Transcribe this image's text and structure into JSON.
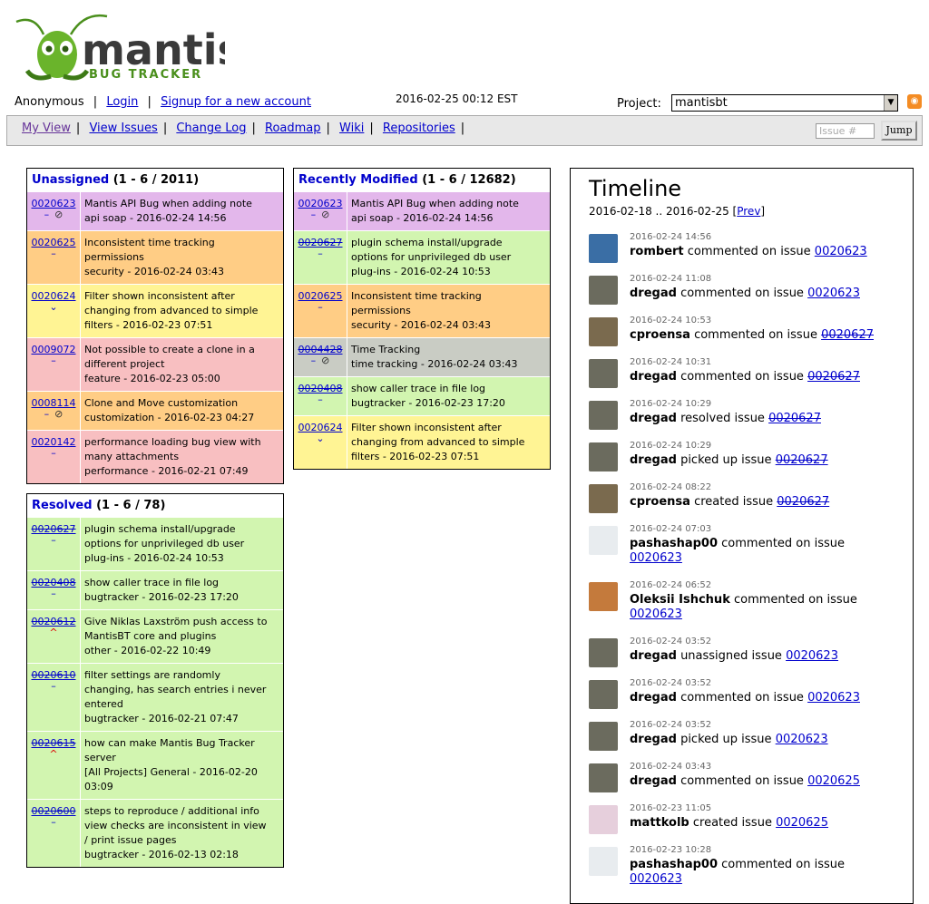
{
  "header": {
    "logo_text": "mantis",
    "logo_subtext": "BUG TRACKER",
    "user": "Anonymous",
    "login": "Login",
    "signup": "Signup for a new account",
    "datetime": "2016-02-25 00:12 EST",
    "project_label": "Project:",
    "project_value": "mantisbt"
  },
  "menu": {
    "items": [
      "My View",
      "View Issues",
      "Change Log",
      "Roadmap",
      "Wiki",
      "Repositories"
    ],
    "issue_placeholder": "Issue #",
    "jump": "Jump"
  },
  "unassigned": {
    "title": "Unassigned",
    "count": "(1 - 6 / 2011)",
    "rows": [
      {
        "id": "0020623",
        "icon": "–",
        "attach": true,
        "lines": [
          "Mantis API Bug when adding note",
          "api soap - 2016-02-24 14:56"
        ],
        "color": "purple",
        "resolved": false
      },
      {
        "id": "0020625",
        "icon": "–",
        "attach": false,
        "lines": [
          "Inconsistent time tracking",
          "permissions",
          "security - 2016-02-24 03:43"
        ],
        "color": "orange",
        "resolved": false
      },
      {
        "id": "0020624",
        "icon": "⌄",
        "attach": false,
        "lines": [
          "Filter shown inconsistent after",
          "changing from advanced to simple",
          "filters - 2016-02-23 07:51"
        ],
        "color": "yellow",
        "resolved": false
      },
      {
        "id": "0009072",
        "icon": "–",
        "attach": false,
        "lines": [
          "Not possible to create a clone in a",
          "different project",
          "feature - 2016-02-23 05:00"
        ],
        "color": "pink",
        "resolved": false
      },
      {
        "id": "0008114",
        "icon": "–",
        "attach": true,
        "lines": [
          "Clone and Move customization",
          "customization - 2016-02-23 04:27"
        ],
        "color": "orange",
        "resolved": false
      },
      {
        "id": "0020142",
        "icon": "–",
        "attach": false,
        "lines": [
          "performance loading bug view with",
          "many attachments",
          "performance - 2016-02-21 07:49"
        ],
        "color": "pink",
        "resolved": false
      }
    ]
  },
  "recent": {
    "title": "Recently Modified",
    "count": "(1 - 6 / 12682)",
    "rows": [
      {
        "id": "0020623",
        "icon": "–",
        "attach": true,
        "lines": [
          "Mantis API Bug when adding note",
          "api soap - 2016-02-24 14:56"
        ],
        "color": "purple",
        "resolved": false
      },
      {
        "id": "0020627",
        "icon": "–",
        "attach": false,
        "lines": [
          "plugin schema install/upgrade",
          "options for unprivileged db user",
          "plug-ins - 2016-02-24 10:53"
        ],
        "color": "green",
        "resolved": true
      },
      {
        "id": "0020625",
        "icon": "–",
        "attach": false,
        "lines": [
          "Inconsistent time tracking",
          "permissions",
          "security - 2016-02-24 03:43"
        ],
        "color": "orange",
        "resolved": false
      },
      {
        "id": "0004428",
        "icon": "–",
        "attach": true,
        "lines": [
          "Time Tracking",
          "time tracking - 2016-02-24 03:43"
        ],
        "color": "gray",
        "resolved": true
      },
      {
        "id": "0020408",
        "icon": "–",
        "attach": false,
        "lines": [
          "show caller trace in file log",
          "bugtracker - 2016-02-23 17:20"
        ],
        "color": "green",
        "resolved": true
      },
      {
        "id": "0020624",
        "icon": "⌄",
        "attach": false,
        "lines": [
          "Filter shown inconsistent after",
          "changing from advanced to simple",
          "filters - 2016-02-23 07:51"
        ],
        "color": "yellow",
        "resolved": false
      }
    ]
  },
  "resolved": {
    "title": "Resolved",
    "count": "(1 - 6 / 78)",
    "rows": [
      {
        "id": "0020627",
        "icon": "–",
        "attach": false,
        "lines": [
          "plugin schema install/upgrade",
          "options for unprivileged db user",
          "plug-ins - 2016-02-24 10:53"
        ],
        "color": "green",
        "resolved": true
      },
      {
        "id": "0020408",
        "icon": "–",
        "attach": false,
        "lines": [
          "show caller trace in file log",
          "bugtracker - 2016-02-23 17:20"
        ],
        "color": "green",
        "resolved": true
      },
      {
        "id": "0020612",
        "icon": "^",
        "attach": false,
        "lines": [
          "Give Niklas Laxström push access to",
          "MantisBT core and plugins",
          "other - 2016-02-22 10:49"
        ],
        "color": "green",
        "resolved": true
      },
      {
        "id": "0020610",
        "icon": "–",
        "attach": false,
        "lines": [
          "filter settings are randomly",
          "changing, has search entries i never",
          "entered",
          "bugtracker - 2016-02-21 07:47"
        ],
        "color": "green",
        "resolved": true
      },
      {
        "id": "0020615",
        "icon": "^",
        "attach": false,
        "lines": [
          "how can make Mantis Bug Tracker",
          "server",
          "[All Projects] General - 2016-02-20",
          "03:09"
        ],
        "color": "green",
        "resolved": true
      },
      {
        "id": "0020600",
        "icon": "–",
        "attach": false,
        "lines": [
          "steps to reproduce / additional info",
          "view checks are inconsistent in view",
          "/ print issue pages",
          "bugtracker - 2016-02-13 02:18"
        ],
        "color": "green",
        "resolved": true
      }
    ]
  },
  "timeline": {
    "title": "Timeline",
    "range": "2016-02-18 .. 2016-02-25",
    "prev": "Prev",
    "events": [
      {
        "time": "2016-02-24 14:56",
        "user": "rombert",
        "action": "commented on issue",
        "issue": "0020623",
        "resolved": false,
        "avatar": "#3a6ea5",
        "wrap": false
      },
      {
        "time": "2016-02-24 11:08",
        "user": "dregad",
        "action": "commented on issue",
        "issue": "0020623",
        "resolved": false,
        "avatar": "#6b6b5e",
        "wrap": false
      },
      {
        "time": "2016-02-24 10:53",
        "user": "cproensa",
        "action": "commented on issue",
        "issue": "0020627",
        "resolved": true,
        "avatar": "#7a6a4e",
        "wrap": false
      },
      {
        "time": "2016-02-24 10:31",
        "user": "dregad",
        "action": "commented on issue",
        "issue": "0020627",
        "resolved": true,
        "avatar": "#6b6b5e",
        "wrap": false
      },
      {
        "time": "2016-02-24 10:29",
        "user": "dregad",
        "action": "resolved issue",
        "issue": "0020627",
        "resolved": true,
        "avatar": "#6b6b5e",
        "wrap": false
      },
      {
        "time": "2016-02-24 10:29",
        "user": "dregad",
        "action": "picked up issue",
        "issue": "0020627",
        "resolved": true,
        "avatar": "#6b6b5e",
        "wrap": false
      },
      {
        "time": "2016-02-24 08:22",
        "user": "cproensa",
        "action": "created issue",
        "issue": "0020627",
        "resolved": true,
        "avatar": "#7a6a4e",
        "wrap": false
      },
      {
        "time": "2016-02-24 07:03",
        "user": "pashashap00",
        "action": "commented on issue",
        "issue": "0020623",
        "resolved": false,
        "avatar": "#e8ecef",
        "wrap": true
      },
      {
        "time": "2016-02-24 06:52",
        "user": "Oleksii Ishchuk",
        "action": "commented on issue",
        "issue": "0020623",
        "resolved": false,
        "avatar": "#c47a3c",
        "wrap": true
      },
      {
        "time": "2016-02-24 03:52",
        "user": "dregad",
        "action": "unassigned issue",
        "issue": "0020623",
        "resolved": false,
        "avatar": "#6b6b5e",
        "wrap": false
      },
      {
        "time": "2016-02-24 03:52",
        "user": "dregad",
        "action": "commented on issue",
        "issue": "0020623",
        "resolved": false,
        "avatar": "#6b6b5e",
        "wrap": false
      },
      {
        "time": "2016-02-24 03:52",
        "user": "dregad",
        "action": "picked up issue",
        "issue": "0020623",
        "resolved": false,
        "avatar": "#6b6b5e",
        "wrap": false
      },
      {
        "time": "2016-02-24 03:43",
        "user": "dregad",
        "action": "commented on issue",
        "issue": "0020625",
        "resolved": false,
        "avatar": "#6b6b5e",
        "wrap": false
      },
      {
        "time": "2016-02-23 11:05",
        "user": "mattkolb",
        "action": "created issue",
        "issue": "0020625",
        "resolved": false,
        "avatar": "#e6cfdc",
        "wrap": false
      },
      {
        "time": "2016-02-23 10:28",
        "user": "pashashap00",
        "action": "commented on issue",
        "issue": "0020623",
        "resolved": false,
        "avatar": "#e8ecef",
        "wrap": true
      }
    ]
  }
}
